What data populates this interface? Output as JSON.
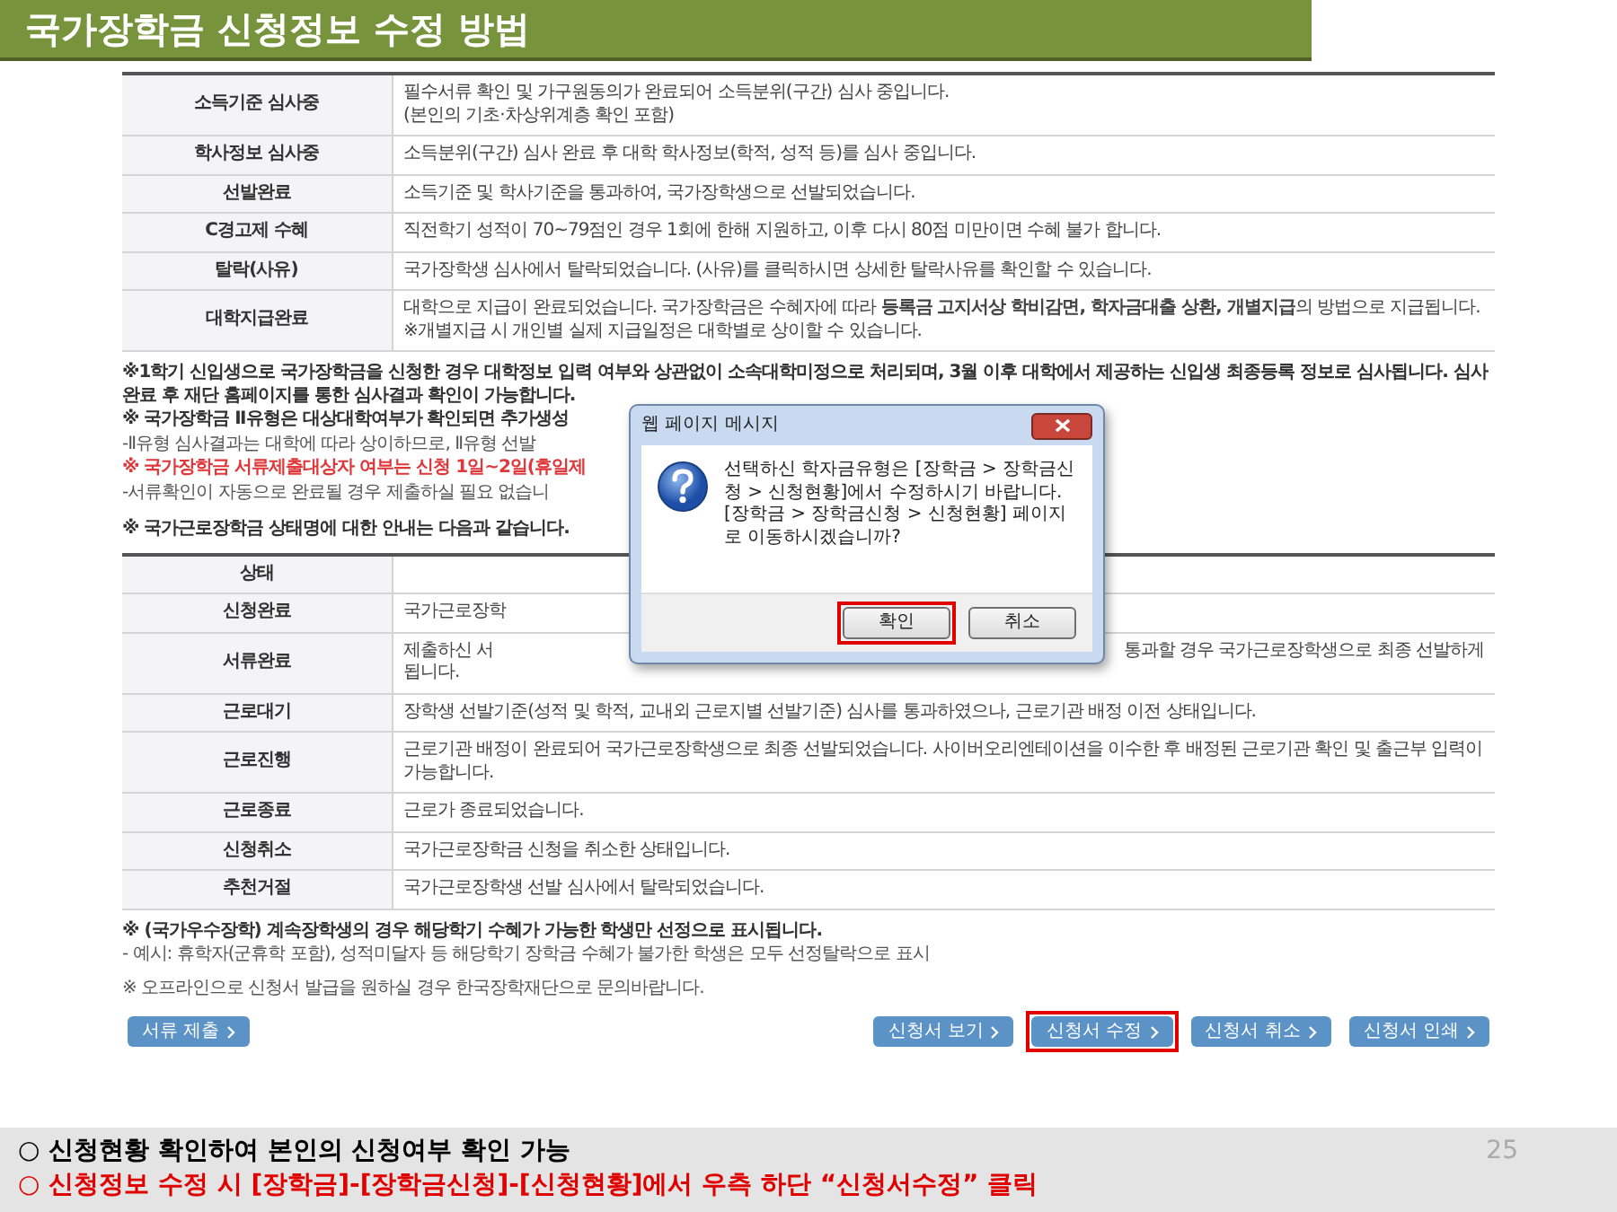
{
  "slide_title": "국가장학금 신청정보 수정 방법",
  "status_table": {
    "rows": [
      {
        "status": "소득기준 심사중",
        "lines": [
          "필수서류 확인 및 가구원동의가 완료되어 소득분위(구간) 심사 중입니다.",
          "(본인의 기초·차상위계층 확인 포함)"
        ]
      },
      {
        "status": "학사정보 심사중",
        "lines": [
          "소득분위(구간) 심사 완료 후 대학 학사정보(학적, 성적 등)를 심사 중입니다."
        ]
      },
      {
        "status": "선발완료",
        "lines": [
          "소득기준 및 학사기준을 통과하여, 국가장학생으로 선발되었습니다."
        ]
      },
      {
        "status": "C경고제 수혜",
        "lines": [
          "직전학기 성적이 70~79점인 경우 1회에 한해 지원하고, 이후 다시 80점 미만이면 수혜 불가 합니다."
        ]
      },
      {
        "status": "탈락(사유)",
        "lines": [
          "국가장학생 심사에서 탈락되었습니다. (사유)를 클릭하시면 상세한 탈락사유를 확인할 수 있습니다."
        ]
      },
      {
        "status": "대학지급완료",
        "lines": [
          "대학으로 지급이 완료되었습니다. 국가장학금은 수혜자에 따라 **등록금 고지서상 학비감면, 학자금대출 상환, 개별지급**의 방법으로 지급됩니다.",
          "※개별지급 시 개인별 실제 지급일정은 대학별로 상이할 수 있습니다."
        ]
      }
    ]
  },
  "notes": [
    {
      "kind": "bold",
      "text": "※1학기 신입생으로 국가장학금을 신청한 경우 대학정보 입력 여부와 상관없이 소속대학미정으로 처리되며, 3월 이후 대학에서 제공하는 신입생 최종등록 정보로 심사됩니다. 심사완료 후 재단 홈페이지를 통한 심사결과 확인이 가능합니다."
    },
    {
      "kind": "bold",
      "text": "※ 국가장학금 Ⅱ유형은 대상대학여부가 확인되면 추가생성"
    },
    {
      "kind": "plain",
      "text": "-Ⅱ유형 심사결과는 대학에 따라 상이하므로, Ⅱ유형 선발"
    },
    {
      "kind": "red",
      "text": "※ 국가장학금 서류제출대상자 여부는 신청 1일~2일(휴일제"
    },
    {
      "kind": "plain",
      "text": "-서류확인이 자동으로 완료될 경우 제출하실 필요 없습니"
    }
  ],
  "work_table": {
    "caption": "※ 국가근로장학금 상태명에 대한 안내는 다음과 같습니다.",
    "header": "상태",
    "rows": [
      {
        "status": "신청완료",
        "lines": [
          "국가근로장학"
        ]
      },
      {
        "status": "서류완료",
        "partial_line": {
          "start": "제출하신 서",
          "end": "통과할 경우 국가근로장학생으로 최종 선발하게"
        },
        "lines": [
          "됩니다."
        ]
      },
      {
        "status": "근로대기",
        "lines": [
          "장학생 선발기준(성적 및 학적, 교내외 근로지별 선발기준) 심사를 통과하였으나, 근로기관 배정 이전 상태입니다."
        ]
      },
      {
        "status": "근로진행",
        "lines": [
          "근로기관 배정이 완료되어 국가근로장학생으로 최종 선발되었습니다. 사이버오리엔테이션을 이수한 후 배정된 근로기관 확인 및 출근부 입력이 가능합니다."
        ]
      },
      {
        "status": "근로종료",
        "lines": [
          "근로가 종료되었습니다."
        ]
      },
      {
        "status": "신청취소",
        "lines": [
          "국가근로장학금 신청을 취소한 상태입니다."
        ]
      },
      {
        "status": "추천거절",
        "lines": [
          "국가근로장학생 선발 심사에서 탈락되었습니다."
        ]
      }
    ]
  },
  "bottom_notes": [
    {
      "kind": "bold",
      "text": "※ (국가우수장학) 계속장학생의 경우 해당학기 수혜가 가능한 학생만 선정으로 표시됩니다."
    },
    {
      "kind": "plain",
      "text": "- 예시: 휴학자(군휴학 포함), 성적미달자 등 해당학기 장학금 수혜가 불가한 학생은 모두 선정탈락으로 표시"
    },
    {
      "kind": "plain",
      "text": "※ 오프라인으로 신청서 발급을 원하실 경우 한국장학재단으로 문의바랍니다."
    }
  ],
  "buttons_left": [
    {
      "label": "서류 제출",
      "highlighted": false
    }
  ],
  "buttons_right": [
    {
      "label": "신청서 보기",
      "highlighted": false
    },
    {
      "label": "신청서 수정",
      "highlighted": true
    },
    {
      "label": "신청서 취소",
      "highlighted": false
    },
    {
      "label": "신청서 인쇄",
      "highlighted": false
    }
  ],
  "dialog": {
    "title": "웹 페이지 메시지",
    "message": "선택하신 학자금유형은 [장학금 > 장학금신청 > 신청현황]에서 수정하시기 바랍니다. [장학금 > 장학금신청 > 신청현황] 페이지로 이동하시겠습니까?",
    "buttons": [
      {
        "label": "확인",
        "highlighted": true
      },
      {
        "label": "취소",
        "highlighted": false
      }
    ]
  },
  "footer": {
    "lines": [
      {
        "text": "○ 신청현황 확인하여 본인의 신청여부 확인 가능",
        "color": "#000000"
      },
      {
        "text": "○ 신청정보 수정 시 [장학금]-[장학금신청]-[신청현황]에서 우측 하단 “신청서수정” 클릭",
        "color": "#e00000"
      }
    ],
    "page_number": "25"
  }
}
